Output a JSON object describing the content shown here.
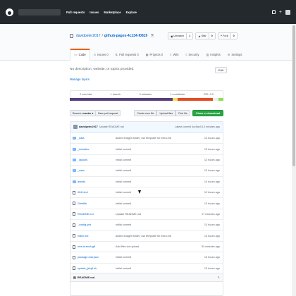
{
  "header": {
    "nav": [
      "Pull requests",
      "Issues",
      "Marketplace",
      "Explore"
    ]
  },
  "repo": {
    "owner": "davidpeter2017",
    "name": "github-pages-4c134-f0819",
    "watch_label": "Unwatch",
    "watch_count": "1",
    "star_label": "Star",
    "star_count": "0",
    "fork_label": "Fork",
    "fork_count": "0"
  },
  "tabs": [
    {
      "label": "Code",
      "icon": "code-icon"
    },
    {
      "label": "Issues 0",
      "icon": "issue-icon"
    },
    {
      "label": "Pull requests 0",
      "icon": "pr-icon"
    },
    {
      "label": "Projects 0",
      "icon": "project-icon"
    },
    {
      "label": "Wiki",
      "icon": "wiki-icon"
    },
    {
      "label": "Security",
      "icon": "shield-icon"
    },
    {
      "label": "Insights",
      "icon": "graph-icon"
    },
    {
      "label": "Settings",
      "icon": "gear-icon"
    }
  ],
  "description": "No description, website, or topics provided.",
  "manage_topics": "Manage topics",
  "edit_label": "Edit",
  "summary": {
    "commits": "2 commits",
    "branches": "1 branch",
    "releases": "0 releases",
    "contributors": "1 contributor",
    "license": "GPL-3.0"
  },
  "languages": [
    {
      "name": "CSS",
      "color": "#563d7c",
      "share": 0.67
    },
    {
      "name": "JavaScript",
      "color": "#f1e05a",
      "share": 0.03
    },
    {
      "name": "HTML",
      "color": "#e34c26",
      "share": 0.23
    },
    {
      "name": "Other",
      "color": "#ededed",
      "share": 0.04
    },
    {
      "name": "Shell",
      "color": "#89e051",
      "share": 0.03
    }
  ],
  "controls": {
    "branch_label": "Branch:",
    "branch_name": "master",
    "new_pr": "New pull request",
    "create_file": "Create new file",
    "upload_files": "Upload files",
    "find_file": "Find file",
    "clone": "Clone or download"
  },
  "latest_commit": {
    "author": "davidpeter2017",
    "message": "Update README.md",
    "meta": "Latest commit 4cc9ac0 13 minutes ago"
  },
  "files": [
    {
      "name": "_data",
      "type": "dir",
      "message": "added images folder, css template for extra.md",
      "age": "13 hours ago"
    },
    {
      "name": "_includes",
      "type": "dir",
      "message": "initial commit",
      "age": "13 hours ago"
    },
    {
      "name": "_layouts",
      "type": "dir",
      "message": "initial commit",
      "age": "13 hours ago"
    },
    {
      "name": "_sass",
      "type": "dir",
      "message": "initial commit",
      "age": "13 hours ago"
    },
    {
      "name": "assets",
      "type": "dir",
      "message": "initial commit",
      "age": "13 hours ago"
    },
    {
      "name": "404.html",
      "type": "file",
      "message": "initial commit",
      "age": "13 hours ago"
    },
    {
      "name": "Gemfile",
      "type": "file",
      "message": "initial commit",
      "age": "13 hours ago"
    },
    {
      "name": "README.md",
      "type": "file",
      "message": "Update README.md",
      "age": "17 minutes ago"
    },
    {
      "name": "_config.yml",
      "type": "file",
      "message": "initial commit",
      "age": "13 hours ago"
    },
    {
      "name": "index.md",
      "type": "file",
      "message": "added images folder, css template for extra.md",
      "age": "13 hours ago"
    },
    {
      "name": "new-branch.gif",
      "type": "file",
      "message": "Add files via upload",
      "age": "34 minutes ago"
    },
    {
      "name": "package-lock.json",
      "type": "file",
      "message": "initial commit",
      "age": "13 hours ago"
    },
    {
      "name": "update_jekyll.sh",
      "type": "file",
      "message": "initial commit",
      "age": "13 hours ago"
    }
  ],
  "readme": {
    "title": "README.md"
  }
}
